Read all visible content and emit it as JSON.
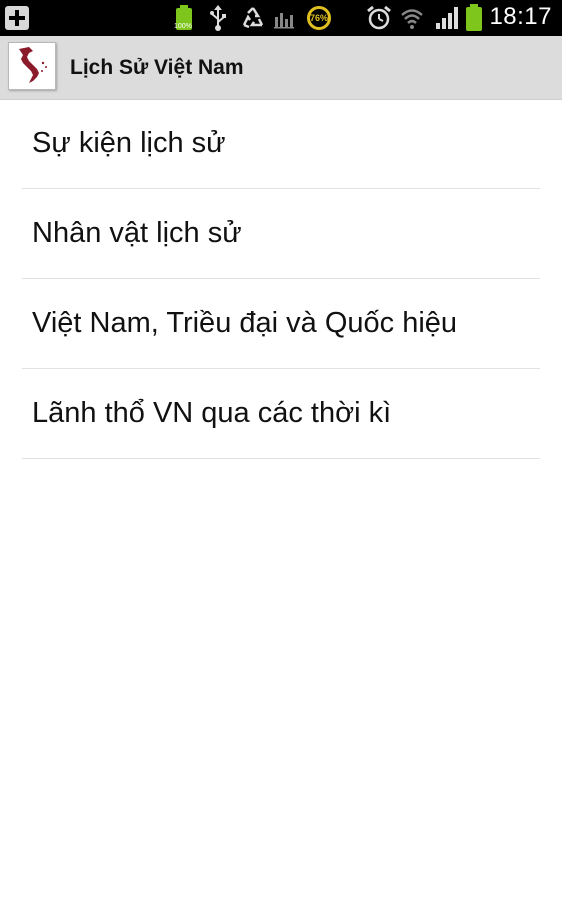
{
  "status_bar": {
    "time": "18:17",
    "battery_small_label": "100%",
    "ring_percent": "76%",
    "icons": [
      "add-notification-icon",
      "battery-full-icon",
      "usb-icon",
      "recycle-icon",
      "bar-graph-icon",
      "ring-gauge-icon",
      "alarm-icon",
      "wifi-icon",
      "signal-icon",
      "battery-icon"
    ]
  },
  "action_bar": {
    "title": "Lịch Sử Việt Nam",
    "app_icon": "vietnam-map-icon"
  },
  "menu": {
    "items": [
      {
        "label": "Sự kiện lịch sử"
      },
      {
        "label": "Nhân vật lịch sử"
      },
      {
        "label": "Việt Nam, Triều đại và Quốc hiệu"
      },
      {
        "label": "Lãnh thổ VN qua các thời kì"
      }
    ]
  },
  "colors": {
    "status_bar_bg": "#000000",
    "action_bar_bg": "#dcdcdc",
    "battery_green": "#7ec51c",
    "map_red": "#8b1a2a",
    "divider": "#e2e2e2"
  }
}
